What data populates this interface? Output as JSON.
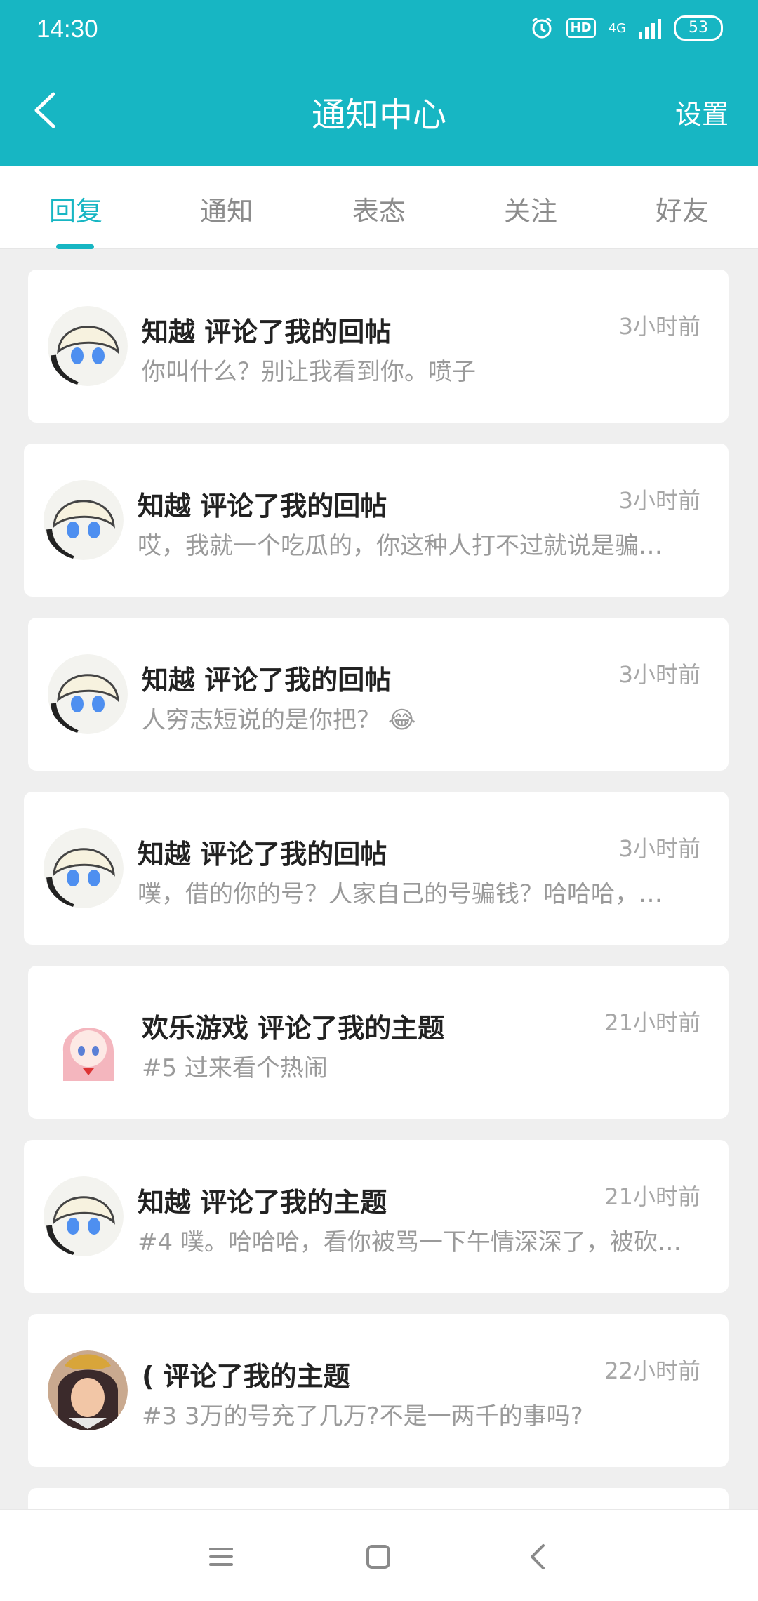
{
  "status": {
    "time": "14:30",
    "hd": "HD",
    "network": "4G",
    "battery": "53"
  },
  "header": {
    "title": "通知中心",
    "settings": "设置"
  },
  "tabs": [
    {
      "label": "回复",
      "active": true
    },
    {
      "label": "通知"
    },
    {
      "label": "表态"
    },
    {
      "label": "关注"
    },
    {
      "label": "好友"
    }
  ],
  "notifications": [
    {
      "user": "知越",
      "action": "评论了我的回帖",
      "time": "3小时前",
      "preview": "你叫什么？别让我看到你。喷子",
      "avatar": "anime-white-hair-avatar"
    },
    {
      "user": "知越",
      "action": "评论了我的回帖",
      "time": "3小时前",
      "preview": "哎，我就一个吃瓜的，你这种人打不过就说是骗…",
      "avatar": "anime-white-hair-avatar"
    },
    {
      "user": "知越",
      "action": "评论了我的回帖",
      "time": "3小时前",
      "preview": "人穷志短说的是你把？ 😂",
      "avatar": "anime-white-hair-avatar"
    },
    {
      "user": "知越",
      "action": "评论了我的回帖",
      "time": "3小时前",
      "preview": "噗，借的你的号？人家自己的号骗钱？哈哈哈，…",
      "avatar": "anime-white-hair-avatar"
    },
    {
      "user": "欢乐游戏",
      "action": "评论了我的主题",
      "time": "21小时前",
      "preview": "#5 过来看个热闹",
      "avatar": "anime-pink-hair-avatar"
    },
    {
      "user": "知越",
      "action": "评论了我的主题",
      "time": "21小时前",
      "preview": "#4 噗。哈哈哈，看你被骂一下午情深深了，被砍…",
      "avatar": "anime-white-hair-avatar"
    },
    {
      "user": "(",
      "action": "评论了我的主题",
      "time": "22小时前",
      "preview": "#3 3万的号充了几万?不是一两千的事吗?",
      "avatar": "anime-dark-hair-avatar"
    }
  ],
  "colors": {
    "accent": "#17b6c3",
    "background": "#efefef"
  }
}
